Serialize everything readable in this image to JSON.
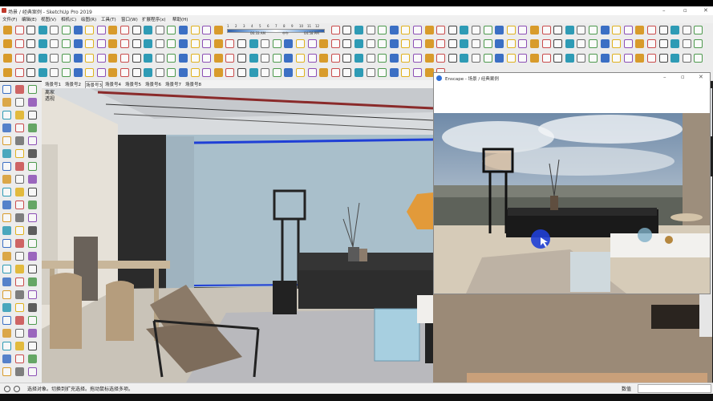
{
  "window": {
    "title": "场景 / 经典案例 - SketchUp Pro 2019",
    "controls": [
      "–",
      "▫",
      "✕"
    ]
  },
  "menu": [
    "文件(F)",
    "编辑(E)",
    "视图(V)",
    "相机(C)",
    "绘图(R)",
    "工具(T)",
    "窗口(W)",
    "扩展程序(x)",
    "帮助(H)"
  ],
  "shadow": {
    "months": [
      "1",
      "2",
      "3",
      "4",
      "5",
      "6",
      "7",
      "8",
      "9",
      "10",
      "11",
      "12"
    ],
    "time_start": "06:33 AM",
    "time_mid": "中午",
    "time_end": "04:58 PM"
  },
  "scene_tabs": [
    "场景号1",
    "场景号2",
    "场景号3",
    "场景号4",
    "场景号5",
    "场景号6",
    "场景号7",
    "场景号8",
    "场景号9"
  ],
  "viewport_label": [
    "离家",
    "透视"
  ],
  "enscape": {
    "title": "Enscape - 场景 / 经典案例",
    "controls": [
      "–",
      "▫",
      "✕"
    ]
  },
  "status": {
    "message": "选择对象。切换到扩充选择。拖动鼠标选择多项。",
    "measure_label": "数值"
  },
  "colors": {
    "accent_blue": "#1f3fd6",
    "wall": "#a9bfcb",
    "floor": "#c9c3b8"
  }
}
